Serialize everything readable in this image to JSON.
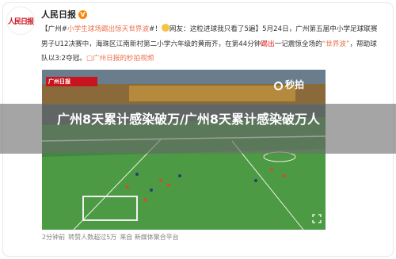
{
  "post": {
    "avatar_text": "人民日报",
    "author": "人民日报",
    "verified": "V",
    "text": {
      "lead": "【广州#",
      "hashtag": "小学生球场踢出惊天世界波",
      "after_hashtag": "#！",
      "rest1": "网友：这粒进球我只看了5遍】5月24日，广州第五届中小学足球联赛男子U12决赛中，海珠区江南新村第二小学六年级的黄雨齐，在第44分钟",
      "red": "踢出",
      "rest2": "一记震惊全场的",
      "quote": "“世界波”",
      "rest3": "，帮助球队以3:2夺冠。",
      "video_link": "广州日报的秒拍视频"
    },
    "meta": {
      "time": "2分钟前",
      "reposts": "转赞人数超过5万",
      "source": "来自 新媒体聚合平台"
    }
  },
  "video": {
    "watermark": "秒拍",
    "logo": "广州日报"
  },
  "overlay": {
    "title": "广州8天累计感染破万/广州8天累计感染破万人"
  }
}
